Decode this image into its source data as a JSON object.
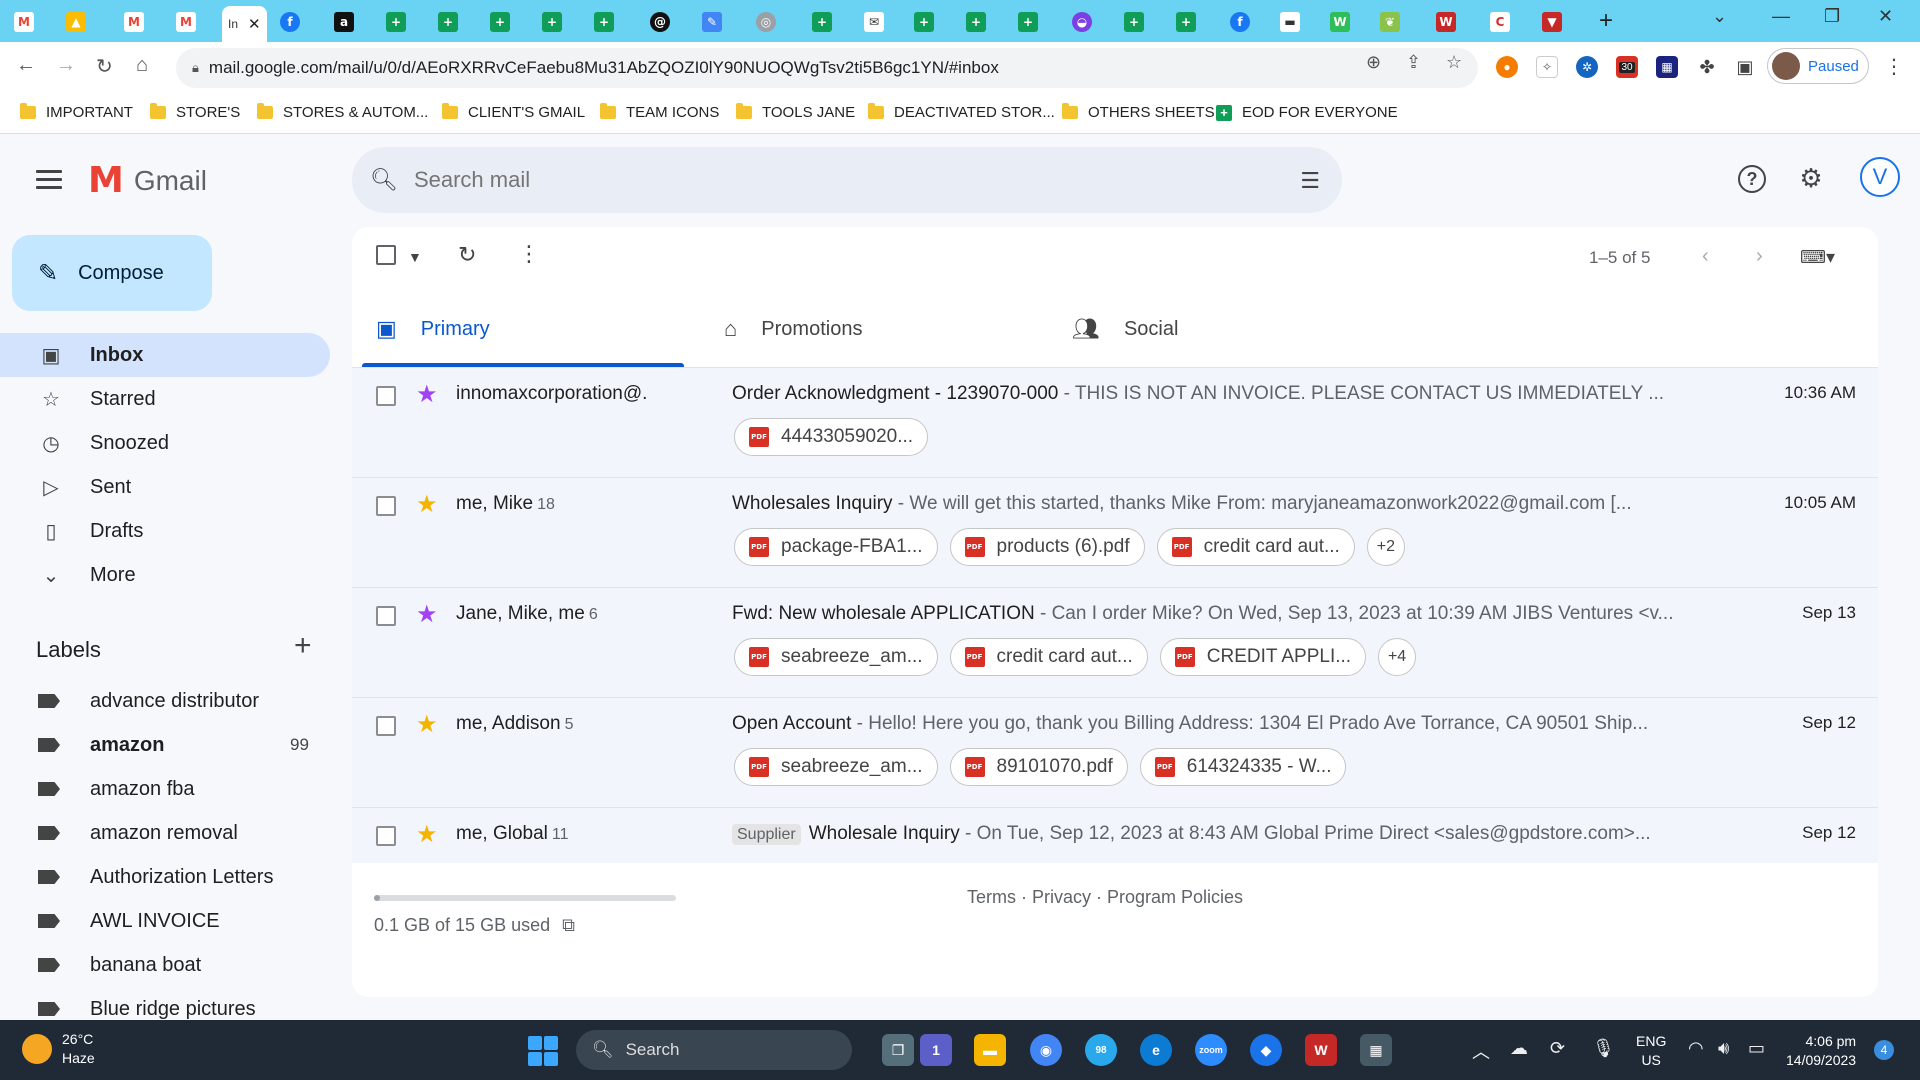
{
  "browser": {
    "active_tab_label": "In",
    "url": "mail.google.com/mail/u/0/d/AEoRXRRvCeFaebu8Mu31AbZQOZI0lY90NUOQWgTsv2ti5B6gc1YN/#inbox",
    "profile_status": "Paused",
    "extension_badge": "30",
    "bookmarks": [
      "IMPORTANT",
      "STORE'S",
      "STORES & AUTOM...",
      "CLIENT'S GMAIL",
      "TEAM ICONS",
      "TOOLS JANE",
      "DEACTIVATED STOR...",
      "OTHERS SHEETS",
      "EOD FOR EVERYONE"
    ]
  },
  "gmail": {
    "brand": "Gmail",
    "search_placeholder": "Search mail",
    "avatar_letter": "V",
    "compose_label": "Compose",
    "nav": [
      {
        "label": "Inbox",
        "icon": "inbox-icon"
      },
      {
        "label": "Starred",
        "icon": "star-icon"
      },
      {
        "label": "Snoozed",
        "icon": "clock-icon"
      },
      {
        "label": "Sent",
        "icon": "send-icon"
      },
      {
        "label": "Drafts",
        "icon": "draft-icon"
      },
      {
        "label": "More",
        "icon": "chevron-down-icon"
      }
    ],
    "labels_title": "Labels",
    "labels": [
      {
        "name": "advance distributor",
        "count": ""
      },
      {
        "name": "amazon",
        "count": "99"
      },
      {
        "name": "amazon fba",
        "count": ""
      },
      {
        "name": "amazon removal",
        "count": ""
      },
      {
        "name": "Authorization Letters",
        "count": ""
      },
      {
        "name": "AWL INVOICE",
        "count": ""
      },
      {
        "name": "banana boat",
        "count": ""
      },
      {
        "name": "Blue ridge pictures",
        "count": ""
      }
    ],
    "pager_text": "1–5 of 5",
    "tabs": [
      {
        "label": "Primary",
        "icon": "inbox-icon"
      },
      {
        "label": "Promotions",
        "icon": "tag-icon"
      },
      {
        "label": "Social",
        "icon": "people-icon"
      }
    ],
    "emails": [
      {
        "sender": "innomaxcorporation@.",
        "count": "",
        "tag": "",
        "subject": "Order Acknowledgment - 1239070-000",
        "snippet": " - THIS IS NOT AN INVOICE. PLEASE CONTACT US IMMEDIATELY ...",
        "time": "10:36 AM",
        "star_color": "#a142f4",
        "attachments": [
          "44433059020..."
        ],
        "more": ""
      },
      {
        "sender": "me, Mike",
        "count": "18",
        "tag": "",
        "subject": "Wholesales Inquiry",
        "snippet": " - We will get this started, thanks Mike From: maryjaneamazonwork2022@gmail.com [...",
        "time": "10:05 AM",
        "star_color": "#f4b400",
        "attachments": [
          "package-FBA1...",
          "products (6).pdf",
          "credit card aut..."
        ],
        "more": "+2"
      },
      {
        "sender": "Jane, Mike, me",
        "count": "6",
        "tag": "",
        "subject": "Fwd: New wholesale APPLICATION",
        "snippet": " - Can I order Mike? On Wed, Sep 13, 2023 at 10:39 AM JIBS Ventures <v...",
        "time": "Sep 13",
        "star_color": "#a142f4",
        "attachments": [
          "seabreeze_am...",
          "credit card aut...",
          "CREDIT APPLI..."
        ],
        "more": "+4"
      },
      {
        "sender": "me, Addison",
        "count": "5",
        "tag": "",
        "subject": "Open Account",
        "snippet": " - Hello! Here you go, thank you Billing Address: 1304 El Prado Ave Torrance, CA 90501 Ship...",
        "time": "Sep 12",
        "star_color": "#f4b400",
        "attachments": [
          "seabreeze_am...",
          "89101070.pdf",
          "614324335 - W..."
        ],
        "more": ""
      },
      {
        "sender": "me, Global",
        "count": "11",
        "tag": "Supplier",
        "subject": "Wholesale Inquiry",
        "snippet": " - On Tue, Sep 12, 2023 at 8:43 AM Global Prime Direct <sales@gpdstore.com>...",
        "time": "Sep 12",
        "star_color": "#f4b400",
        "attachments": [],
        "more": ""
      }
    ],
    "storage_text": "0.1 GB of 15 GB used",
    "storage_fraction": 0.0067,
    "footer_links": "Terms · Privacy · Program Policies"
  },
  "taskbar": {
    "temperature": "26°C",
    "weather": "Haze",
    "search_label": "Search",
    "lang_top": "ENG",
    "lang_bottom": "US",
    "time": "4:06 pm",
    "date": "14/09/2023",
    "notifications": "4",
    "teams_badge": "1",
    "telegram_badge": "98"
  }
}
